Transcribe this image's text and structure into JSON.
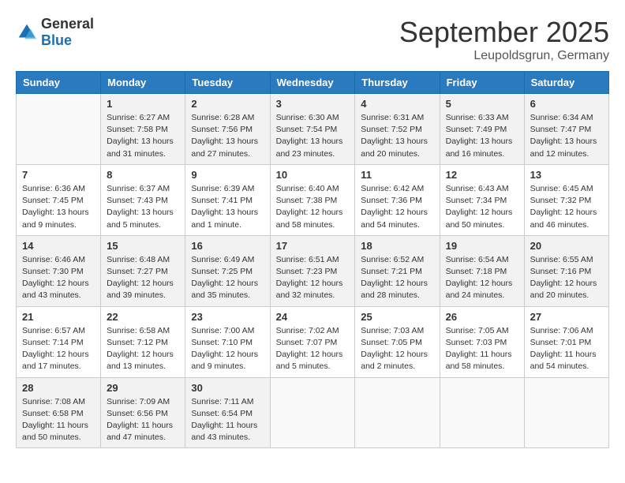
{
  "header": {
    "logo_general": "General",
    "logo_blue": "Blue",
    "month": "September 2025",
    "location": "Leupoldsgrun, Germany"
  },
  "days_of_week": [
    "Sunday",
    "Monday",
    "Tuesday",
    "Wednesday",
    "Thursday",
    "Friday",
    "Saturday"
  ],
  "weeks": [
    [
      {
        "day": "",
        "info": ""
      },
      {
        "day": "1",
        "info": "Sunrise: 6:27 AM\nSunset: 7:58 PM\nDaylight: 13 hours and 31 minutes."
      },
      {
        "day": "2",
        "info": "Sunrise: 6:28 AM\nSunset: 7:56 PM\nDaylight: 13 hours and 27 minutes."
      },
      {
        "day": "3",
        "info": "Sunrise: 6:30 AM\nSunset: 7:54 PM\nDaylight: 13 hours and 23 minutes."
      },
      {
        "day": "4",
        "info": "Sunrise: 6:31 AM\nSunset: 7:52 PM\nDaylight: 13 hours and 20 minutes."
      },
      {
        "day": "5",
        "info": "Sunrise: 6:33 AM\nSunset: 7:49 PM\nDaylight: 13 hours and 16 minutes."
      },
      {
        "day": "6",
        "info": "Sunrise: 6:34 AM\nSunset: 7:47 PM\nDaylight: 13 hours and 12 minutes."
      }
    ],
    [
      {
        "day": "7",
        "info": "Sunrise: 6:36 AM\nSunset: 7:45 PM\nDaylight: 13 hours and 9 minutes."
      },
      {
        "day": "8",
        "info": "Sunrise: 6:37 AM\nSunset: 7:43 PM\nDaylight: 13 hours and 5 minutes."
      },
      {
        "day": "9",
        "info": "Sunrise: 6:39 AM\nSunset: 7:41 PM\nDaylight: 13 hours and 1 minute."
      },
      {
        "day": "10",
        "info": "Sunrise: 6:40 AM\nSunset: 7:38 PM\nDaylight: 12 hours and 58 minutes."
      },
      {
        "day": "11",
        "info": "Sunrise: 6:42 AM\nSunset: 7:36 PM\nDaylight: 12 hours and 54 minutes."
      },
      {
        "day": "12",
        "info": "Sunrise: 6:43 AM\nSunset: 7:34 PM\nDaylight: 12 hours and 50 minutes."
      },
      {
        "day": "13",
        "info": "Sunrise: 6:45 AM\nSunset: 7:32 PM\nDaylight: 12 hours and 46 minutes."
      }
    ],
    [
      {
        "day": "14",
        "info": "Sunrise: 6:46 AM\nSunset: 7:30 PM\nDaylight: 12 hours and 43 minutes."
      },
      {
        "day": "15",
        "info": "Sunrise: 6:48 AM\nSunset: 7:27 PM\nDaylight: 12 hours and 39 minutes."
      },
      {
        "day": "16",
        "info": "Sunrise: 6:49 AM\nSunset: 7:25 PM\nDaylight: 12 hours and 35 minutes."
      },
      {
        "day": "17",
        "info": "Sunrise: 6:51 AM\nSunset: 7:23 PM\nDaylight: 12 hours and 32 minutes."
      },
      {
        "day": "18",
        "info": "Sunrise: 6:52 AM\nSunset: 7:21 PM\nDaylight: 12 hours and 28 minutes."
      },
      {
        "day": "19",
        "info": "Sunrise: 6:54 AM\nSunset: 7:18 PM\nDaylight: 12 hours and 24 minutes."
      },
      {
        "day": "20",
        "info": "Sunrise: 6:55 AM\nSunset: 7:16 PM\nDaylight: 12 hours and 20 minutes."
      }
    ],
    [
      {
        "day": "21",
        "info": "Sunrise: 6:57 AM\nSunset: 7:14 PM\nDaylight: 12 hours and 17 minutes."
      },
      {
        "day": "22",
        "info": "Sunrise: 6:58 AM\nSunset: 7:12 PM\nDaylight: 12 hours and 13 minutes."
      },
      {
        "day": "23",
        "info": "Sunrise: 7:00 AM\nSunset: 7:10 PM\nDaylight: 12 hours and 9 minutes."
      },
      {
        "day": "24",
        "info": "Sunrise: 7:02 AM\nSunset: 7:07 PM\nDaylight: 12 hours and 5 minutes."
      },
      {
        "day": "25",
        "info": "Sunrise: 7:03 AM\nSunset: 7:05 PM\nDaylight: 12 hours and 2 minutes."
      },
      {
        "day": "26",
        "info": "Sunrise: 7:05 AM\nSunset: 7:03 PM\nDaylight: 11 hours and 58 minutes."
      },
      {
        "day": "27",
        "info": "Sunrise: 7:06 AM\nSunset: 7:01 PM\nDaylight: 11 hours and 54 minutes."
      }
    ],
    [
      {
        "day": "28",
        "info": "Sunrise: 7:08 AM\nSunset: 6:58 PM\nDaylight: 11 hours and 50 minutes."
      },
      {
        "day": "29",
        "info": "Sunrise: 7:09 AM\nSunset: 6:56 PM\nDaylight: 11 hours and 47 minutes."
      },
      {
        "day": "30",
        "info": "Sunrise: 7:11 AM\nSunset: 6:54 PM\nDaylight: 11 hours and 43 minutes."
      },
      {
        "day": "",
        "info": ""
      },
      {
        "day": "",
        "info": ""
      },
      {
        "day": "",
        "info": ""
      },
      {
        "day": "",
        "info": ""
      }
    ]
  ]
}
